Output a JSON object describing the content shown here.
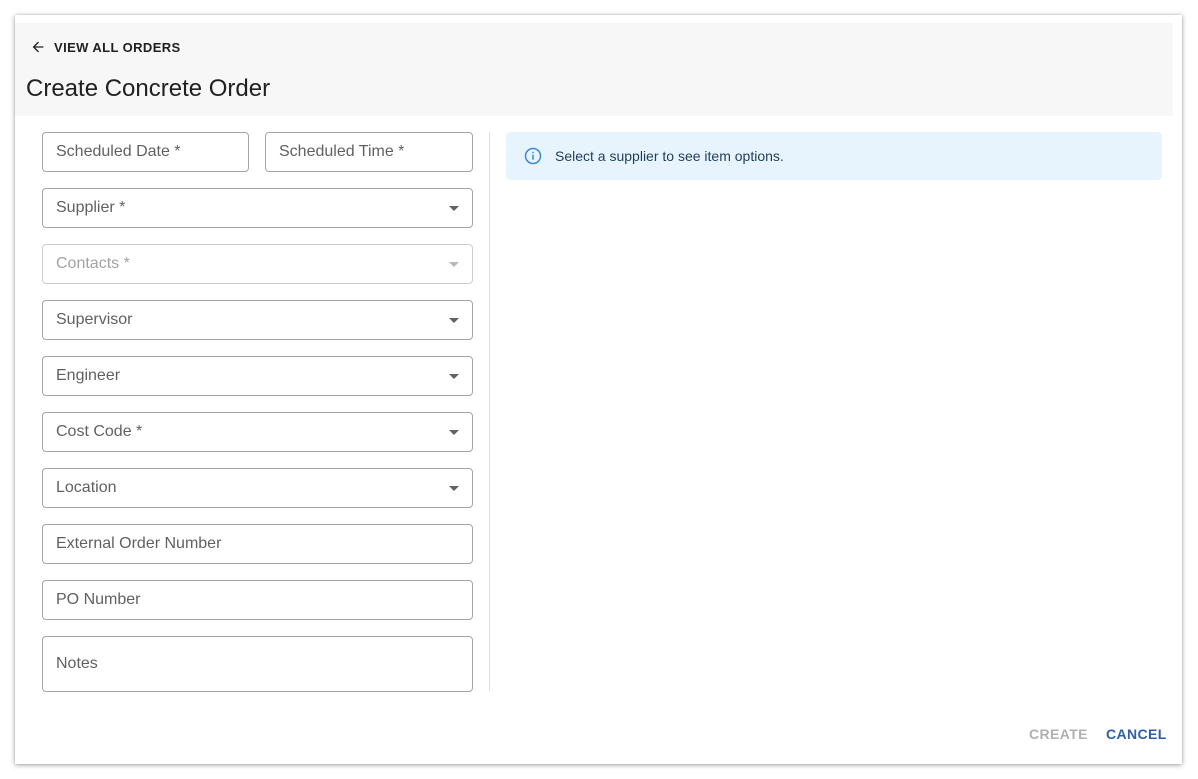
{
  "header": {
    "back_label": "VIEW ALL ORDERS",
    "title": "Create Concrete Order"
  },
  "form": {
    "scheduled_date": "Scheduled Date *",
    "scheduled_time": "Scheduled Time *",
    "supplier": "Supplier *",
    "contacts": "Contacts *",
    "supervisor": "Supervisor",
    "engineer": "Engineer",
    "cost_code": "Cost Code *",
    "location": "Location",
    "external_order_number": "External Order Number",
    "po_number": "PO Number",
    "notes": "Notes"
  },
  "info": {
    "message": "Select a supplier to see item options.",
    "color": "#e8f4fd",
    "icon": "info-icon"
  },
  "actions": {
    "create": "CREATE",
    "cancel": "CANCEL"
  },
  "colors": {
    "accent": "#2f5ea8",
    "disabled": "#b0b0b0",
    "header_bg": "#f7f7f7"
  }
}
